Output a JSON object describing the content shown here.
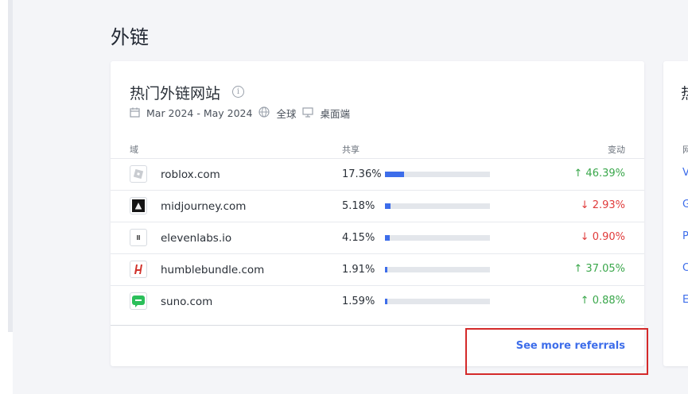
{
  "page": {
    "title": "外链"
  },
  "card": {
    "title": "热门外链网站",
    "date_range": "Mar 2024 - May 2024",
    "region": "全球",
    "device": "桌面端",
    "columns": {
      "domain": "域",
      "share": "共享",
      "change": "变动"
    },
    "rows": [
      {
        "domain": "roblox.com",
        "share": "17.36%",
        "share_value": 17.36,
        "change": "46.39%",
        "direction": "up"
      },
      {
        "domain": "midjourney.com",
        "share": "5.18%",
        "share_value": 5.18,
        "change": "2.93%",
        "direction": "down"
      },
      {
        "domain": "elevenlabs.io",
        "share": "4.15%",
        "share_value": 4.15,
        "change": "0.90%",
        "direction": "down"
      },
      {
        "domain": "humblebundle.com",
        "share": "1.91%",
        "share_value": 1.91,
        "change": "37.05%",
        "direction": "up"
      },
      {
        "domain": "suno.com",
        "share": "1.59%",
        "share_value": 1.59,
        "change": "0.88%",
        "direction": "up"
      }
    ],
    "see_more": "See more referrals"
  },
  "card2": {
    "title_partial": "热",
    "header_partial": "网",
    "link_initials": [
      "V",
      "G",
      "P",
      "C",
      "E"
    ]
  },
  "colors": {
    "accent": "#3d6dea",
    "up": "#3aa74b",
    "down": "#e03a3a",
    "highlight": "#d42a2a"
  },
  "icons": {
    "arrow_up": "↑",
    "arrow_down": "↓",
    "info": "i"
  }
}
